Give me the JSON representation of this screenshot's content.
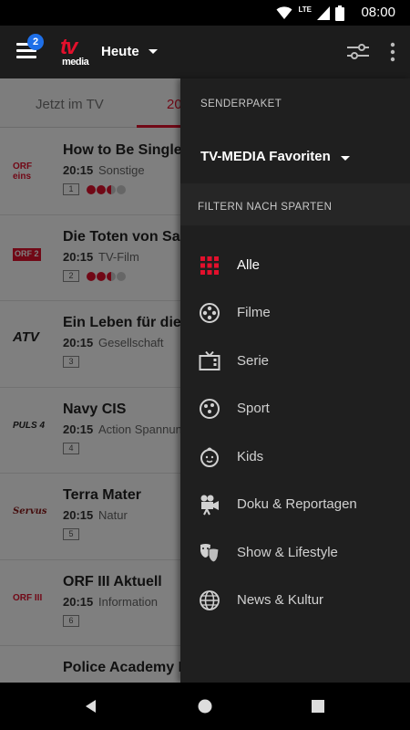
{
  "status_bar": {
    "network": "LTE",
    "time": "08:00"
  },
  "app_bar": {
    "notification_count": "2",
    "logo_top": "tv",
    "logo_bottom": "media",
    "day_selector": "Heute"
  },
  "tabs": [
    {
      "label": "Jetzt im TV"
    },
    {
      "label": "20"
    }
  ],
  "programs": [
    {
      "channel": "ORF eins",
      "title": "How to Be Single",
      "time": "20:15",
      "genre": "Sonstige",
      "channel_no": "1",
      "rating": 2.5
    },
    {
      "channel": "ORF 2",
      "title": "Die Toten von Salz",
      "time": "20:15",
      "genre": "TV-Film",
      "channel_no": "2",
      "rating": 2.5
    },
    {
      "channel": "ATV",
      "title": "Ein Leben für die S",
      "time": "20:15",
      "genre": "Gesellschaft",
      "channel_no": "3",
      "rating": 0
    },
    {
      "channel": "PULS 4",
      "title": "Navy CIS",
      "time": "20:15",
      "genre": "Action Spannun",
      "channel_no": "4",
      "rating": 0
    },
    {
      "channel": "Servus",
      "title": "Terra Mater",
      "time": "20:15",
      "genre": "Natur",
      "channel_no": "5",
      "rating": 0
    },
    {
      "channel": "ORF III",
      "title": "ORF III Aktuell",
      "time": "20:15",
      "genre": "Information",
      "channel_no": "6",
      "rating": 0
    },
    {
      "channel": "",
      "title": "Police Academy II",
      "time": "",
      "genre": "",
      "channel_no": "",
      "rating": 0
    }
  ],
  "drawer": {
    "package_header": "SENDERPAKET",
    "package_value": "TV-MEDIA Favoriten",
    "filter_header": "FILTERN NACH SPARTEN",
    "categories": [
      {
        "label": "Alle",
        "icon": "grid-icon",
        "active": true
      },
      {
        "label": "Filme",
        "icon": "film-reel-icon"
      },
      {
        "label": "Serie",
        "icon": "tv-icon"
      },
      {
        "label": "Sport",
        "icon": "ball-icon"
      },
      {
        "label": "Kids",
        "icon": "baby-face-icon"
      },
      {
        "label": "Doku & Reportagen",
        "icon": "camera-icon"
      },
      {
        "label": "Show & Lifestyle",
        "icon": "theater-masks-icon"
      },
      {
        "label": "News & Kultur",
        "icon": "globe-icon"
      }
    ]
  },
  "colors": {
    "accent": "#e3102c",
    "badge": "#1e6fe8",
    "drawer_bg": "#1f1f1f",
    "appbar_bg": "#1c1c1c"
  }
}
